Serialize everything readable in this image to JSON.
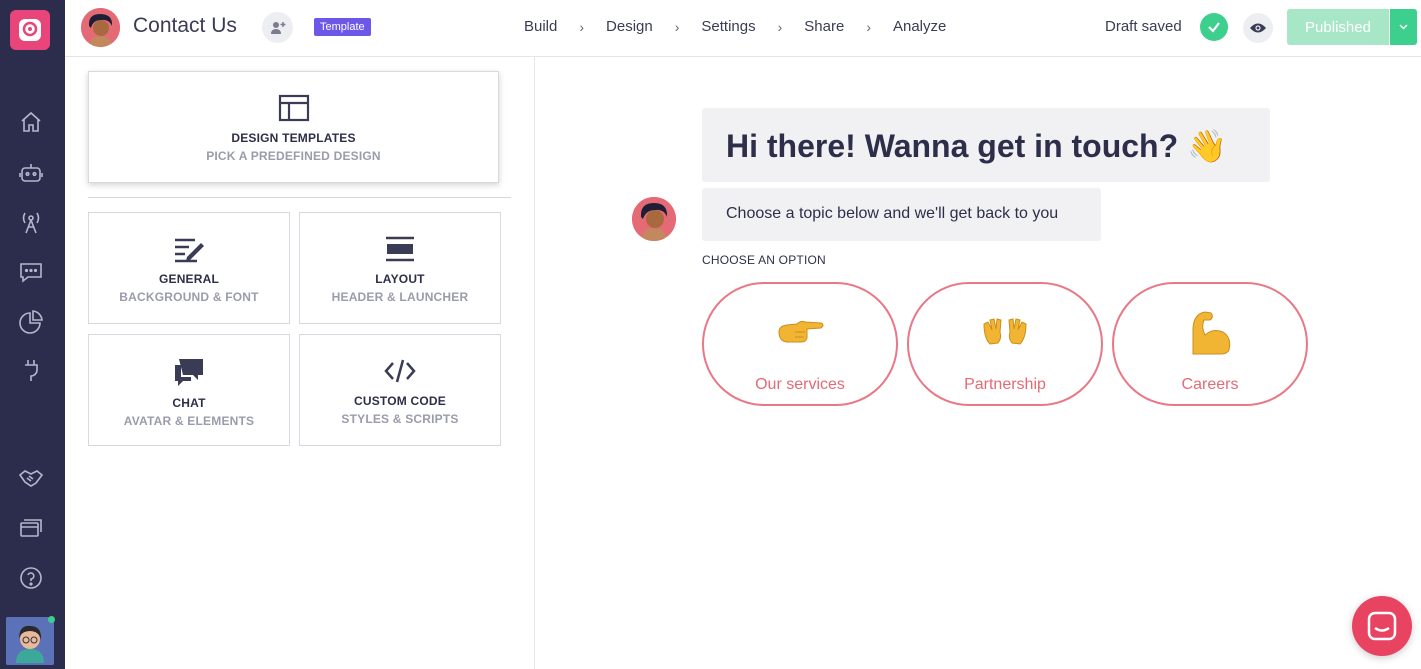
{
  "app": {
    "bot_name": "Contact Us",
    "template_badge": "Template"
  },
  "steps": [
    "Build",
    "Design",
    "Settings",
    "Share",
    "Analyze"
  ],
  "status": {
    "draft_label": "Draft saved",
    "publish_label": "Published"
  },
  "colors": {
    "nav_bg": "#2c2d4c",
    "brand": "#e8457a",
    "accent_purple": "#6b57e8",
    "success": "#3ccf8e",
    "option_border": "#e97886"
  },
  "left_nav_icons": [
    "home-icon",
    "bot-icon",
    "antenna-icon",
    "chat-icon",
    "pie-chart-icon",
    "plug-icon",
    "handshake-icon",
    "billing-icon",
    "help-icon"
  ],
  "design_panel": {
    "templates": {
      "title": "DESIGN TEMPLATES",
      "subtitle": "PICK A PREDEFINED DESIGN"
    },
    "general": {
      "title": "GENERAL",
      "subtitle": "BACKGROUND & FONT"
    },
    "layout": {
      "title": "LAYOUT",
      "subtitle": "HEADER & LAUNCHER"
    },
    "chat": {
      "title": "CHAT",
      "subtitle": "AVATAR & ELEMENTS"
    },
    "custom_code": {
      "title": "CUSTOM CODE",
      "subtitle": "STYLES & SCRIPTS"
    }
  },
  "preview": {
    "greeting": "Hi there! Wanna get in touch? 👋",
    "message": "Choose a topic below and we'll get back to you",
    "choose_label": "CHOOSE AN OPTION",
    "options": [
      {
        "label": "Our services",
        "icon": "pointing-hand-icon"
      },
      {
        "label": "Partnership",
        "icon": "open-hands-icon"
      },
      {
        "label": "Careers",
        "icon": "flexed-bicep-icon"
      }
    ]
  }
}
